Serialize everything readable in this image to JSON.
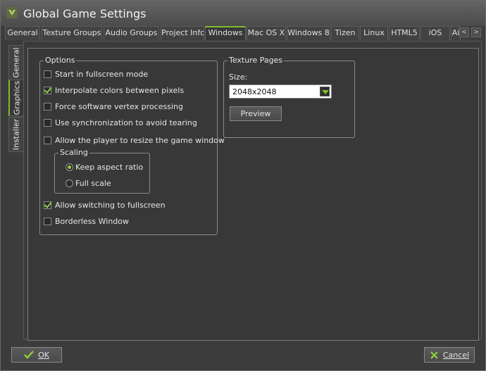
{
  "window": {
    "title": "Global Game Settings",
    "close_glyph": "✕"
  },
  "tabs": [
    {
      "label": "General",
      "active": false
    },
    {
      "label": "Texture Groups",
      "active": false
    },
    {
      "label": "Audio Groups",
      "active": false
    },
    {
      "label": "Project Info",
      "active": false
    },
    {
      "label": "Windows",
      "active": true
    },
    {
      "label": "Mac OS X",
      "active": false
    },
    {
      "label": "Windows 8",
      "active": false
    },
    {
      "label": "Tizen",
      "active": false
    },
    {
      "label": "Linux",
      "active": false
    },
    {
      "label": "HTML5",
      "active": false
    },
    {
      "label": "iOS",
      "active": false
    },
    {
      "label": "Ai",
      "active": false
    }
  ],
  "tab_scroll": {
    "left": "<",
    "right": ">"
  },
  "side_tabs": [
    {
      "label": "General",
      "active": false
    },
    {
      "label": "Graphics",
      "active": true
    },
    {
      "label": "Installer",
      "active": false
    }
  ],
  "options_group": {
    "legend": "Options",
    "items": [
      {
        "label": "Start in fullscreen mode",
        "checked": false
      },
      {
        "label": "Interpolate colors between pixels",
        "checked": true
      },
      {
        "label": "Force software vertex processing",
        "checked": false
      },
      {
        "label": "Use synchronization to avoid tearing",
        "checked": false
      },
      {
        "label": "Allow the player to resize the game window",
        "checked": false
      },
      {
        "label": "Allow switching to fullscreen",
        "checked": true
      },
      {
        "label": "Borderless Window",
        "checked": false
      }
    ],
    "scaling": {
      "legend": "Scaling",
      "options": [
        {
          "label": "Keep aspect ratio",
          "selected": true
        },
        {
          "label": "Full scale",
          "selected": false
        }
      ]
    }
  },
  "texture_group": {
    "legend": "Texture Pages",
    "size_label": "Size:",
    "size_value": "2048x2048",
    "preview_label": "Preview"
  },
  "footer": {
    "ok_label": "OK",
    "cancel_label": "Cancel"
  },
  "colors": {
    "accent": "#7cc02a",
    "background": "#3c3c3c"
  },
  "icons": [
    "gamemaker-logo-icon",
    "close-icon",
    "checkmark-icon",
    "cancel-x-icon",
    "chevron-down-icon"
  ]
}
